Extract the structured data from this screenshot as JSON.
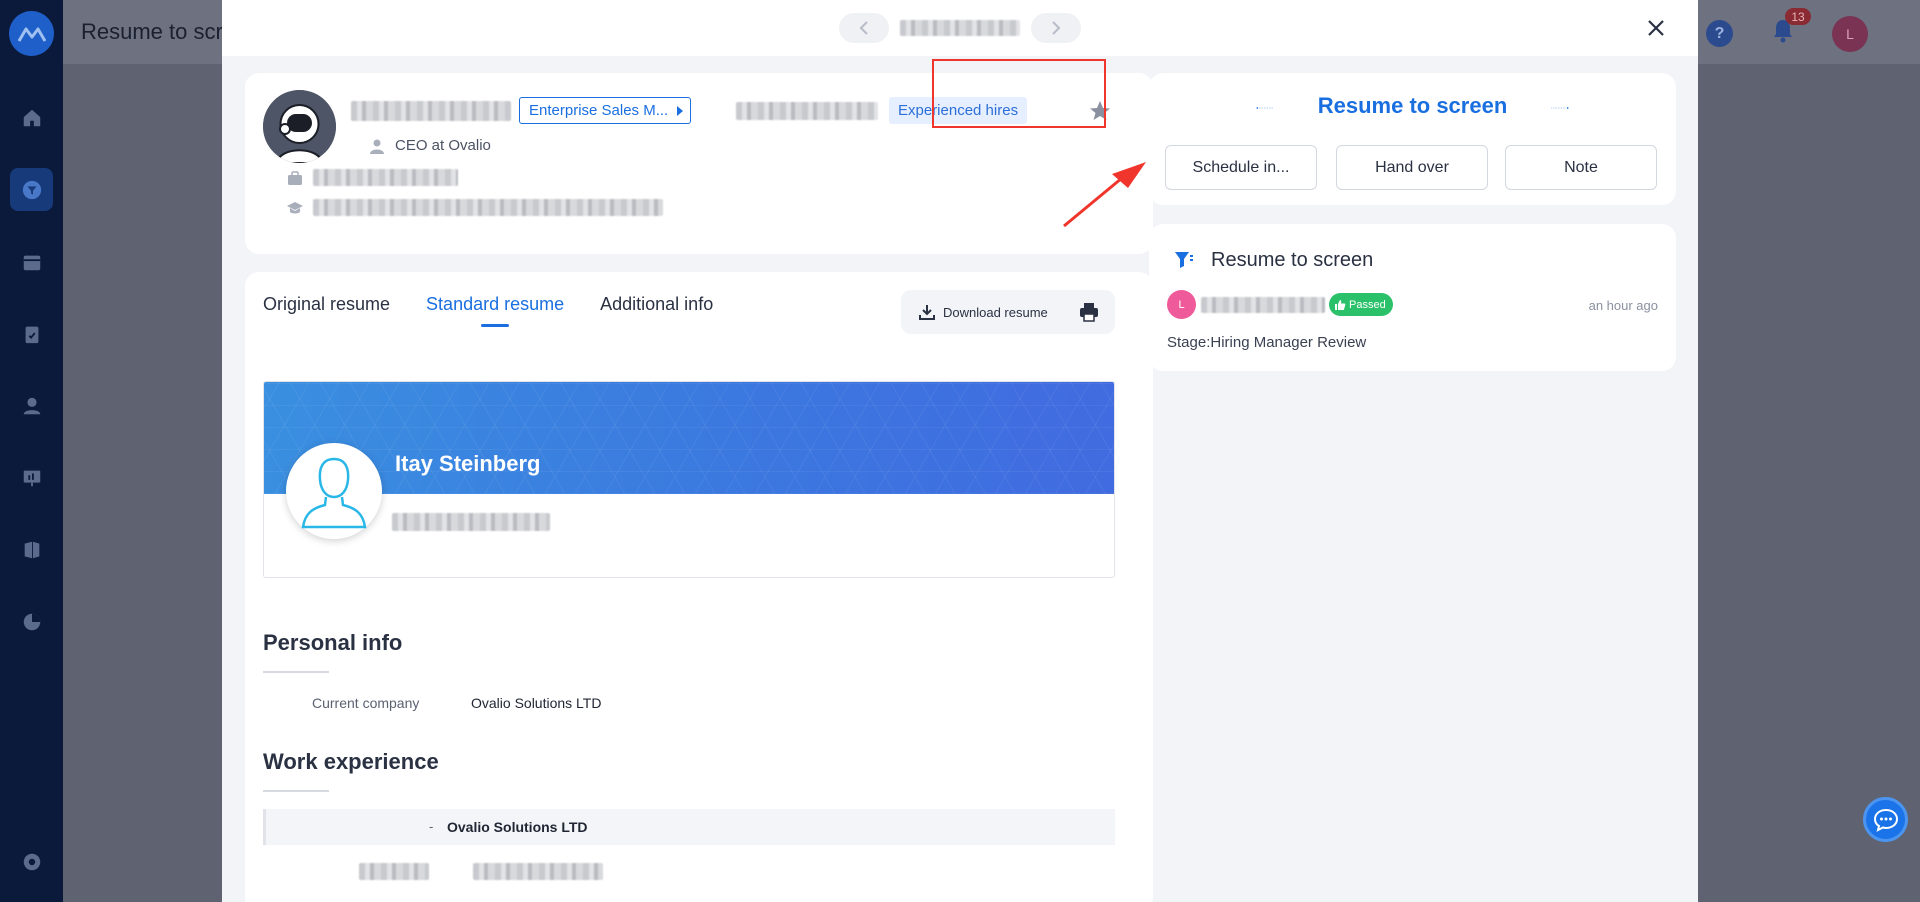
{
  "app": {
    "title": "Resume to scr",
    "notification_count": "13",
    "user_initial": "L",
    "help_label": "?"
  },
  "modal": {
    "candidate": {
      "headline": "CEO at Ovalio",
      "job_tag": "Enterprise Sales M...",
      "hire_type": "Experienced hires"
    },
    "tabs": [
      {
        "label": "Original resume"
      },
      {
        "label": "Standard resume"
      },
      {
        "label": "Additional info"
      }
    ],
    "download_label": "Download resume",
    "resume": {
      "name": "Itay Steinberg",
      "personal_info_title": "Personal info",
      "current_company_label": "Current company",
      "current_company_value": "Ovalio Solutions LTD",
      "work_experience_title": "Work experience",
      "work_dash": "-",
      "work_company": "Ovalio Solutions LTD"
    },
    "stage_panel": {
      "title": "Resume to screen",
      "actions": [
        {
          "label": "Schedule in..."
        },
        {
          "label": "Hand over"
        },
        {
          "label": "Note"
        }
      ]
    },
    "history": {
      "title": "Resume to screen",
      "avatar_initial": "L",
      "status": "Passed",
      "time": "an hour ago",
      "stage_text": "Stage:Hiring Manager Review"
    }
  },
  "colors": {
    "accent": "#1a6fe0",
    "passed": "#2bc06a",
    "highlight": "#f0352c",
    "sidebar": "#0b1a3b"
  }
}
